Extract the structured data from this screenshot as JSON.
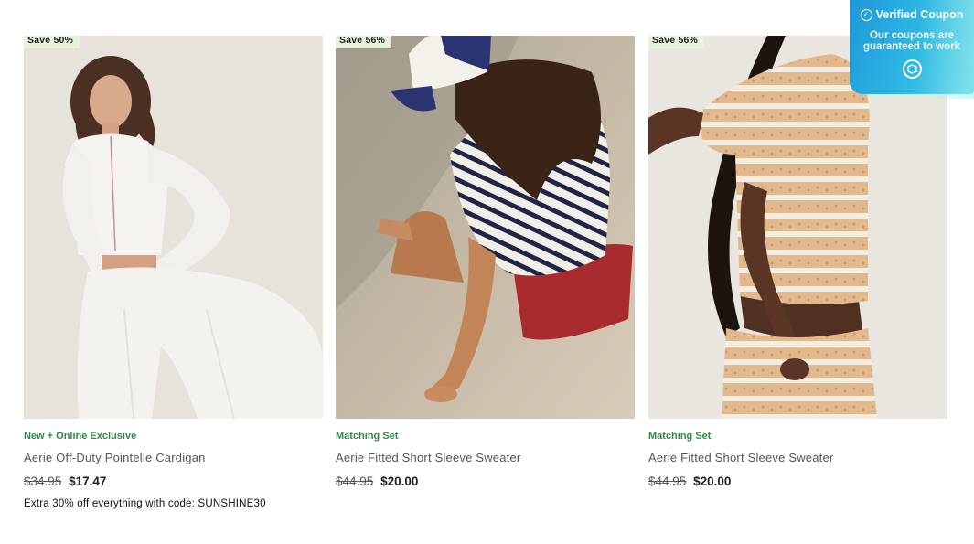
{
  "products": [
    {
      "badge": "Save 50%",
      "tag": "New + Online Exclusive",
      "name": "Aerie Off-Duty Pointelle Cardigan",
      "old_price": "$34.95",
      "new_price": "$17.47",
      "promo": "Extra 30% off everything with code: SUNSHINE30"
    },
    {
      "badge": "Save 56%",
      "tag": "Matching Set",
      "name": "Aerie Fitted Short Sleeve Sweater",
      "old_price": "$44.95",
      "new_price": "$20.00",
      "promo": ""
    },
    {
      "badge": "Save 56%",
      "tag": "Matching Set",
      "name": "Aerie Fitted Short Sleeve Sweater",
      "old_price": "$44.95",
      "new_price": "$20.00",
      "promo": ""
    }
  ],
  "coupon_widget": {
    "title": "Verified Coupon",
    "subtitle_line1": "Our coupons are",
    "subtitle_line2": "guaranteed to work",
    "icon": "check-circle-icon"
  },
  "colors": {
    "badge_bg": "#e9f3dc",
    "tag_green": "#2f8a4a",
    "coupon_blue": "#2fb9e3"
  }
}
